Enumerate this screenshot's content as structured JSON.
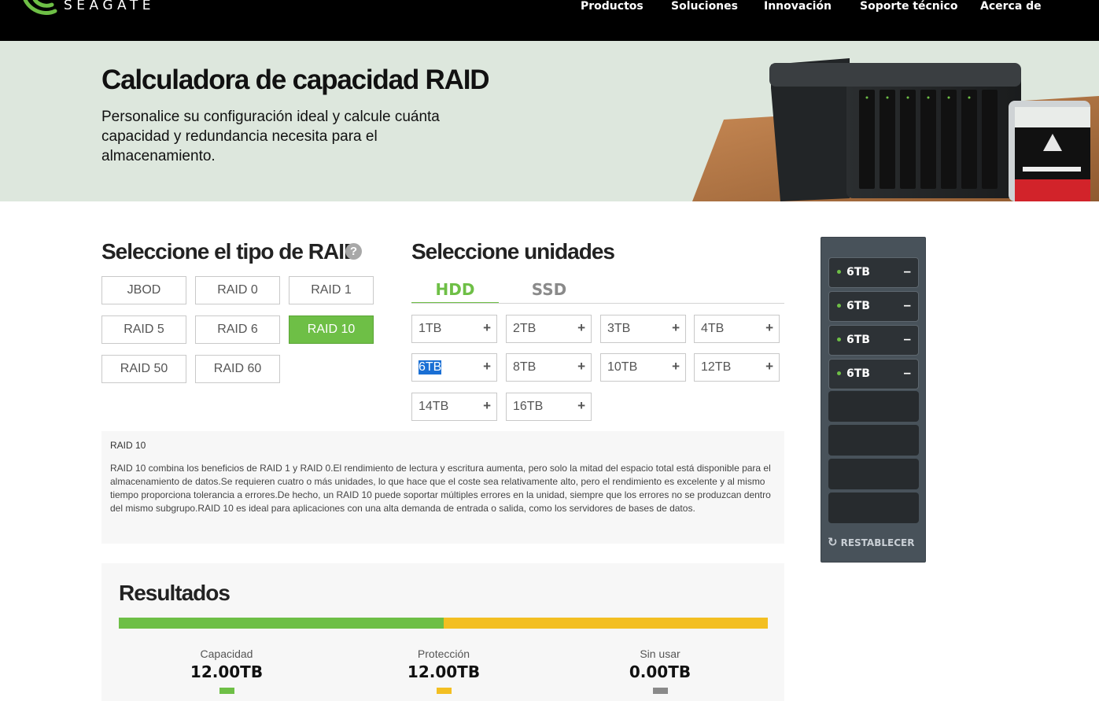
{
  "header": {
    "brand": "SEAGATE",
    "nav": [
      "Productos",
      "Soluciones",
      "Innovación",
      "Soporte técnico",
      "Acerca de"
    ]
  },
  "hero": {
    "title": "Calculadora de capacidad RAID",
    "subtitle": "Personalice su configuración ideal y calcule cuánta capacidad y redundancia necesita para el almacenamiento.",
    "art_icons": [
      "nas-device-image",
      "ironwolf-pro-drive-image"
    ]
  },
  "raid": {
    "heading": "Seleccione el tipo de RAID",
    "help_icon": "?",
    "options": [
      "JBOD",
      "RAID 0",
      "RAID 1",
      "RAID 5",
      "RAID 6",
      "RAID 10",
      "RAID 50",
      "RAID 60"
    ],
    "selected": "RAID 10"
  },
  "drives": {
    "heading": "Seleccione unidades",
    "tabs": [
      "HDD",
      "SSD"
    ],
    "active_tab": "HDD",
    "sizes": [
      "1TB",
      "2TB",
      "3TB",
      "4TB",
      "6TB",
      "8TB",
      "10TB",
      "12TB",
      "14TB",
      "16TB"
    ],
    "highlighted": "6TB",
    "add_icon": "+"
  },
  "description": {
    "title": "RAID 10",
    "body": "RAID 10 combina los beneficios de RAID 1 y RAID 0.El rendimiento de lectura y escritura aumenta, pero solo la mitad del espacio total está disponible para el almacenamiento de datos.Se requieren cuatro o más unidades, lo que hace que el coste sea relativamente alto, pero el rendimiento es excelente y al mismo tiempo proporciona tolerancia a errores.De hecho, un RAID 10 puede soportar múltiples errores en la unidad, siempre que los errores no se produzcan dentro del mismo subgrupo.RAID 10 es ideal para aplicaciones con una alta demanda de entrada o salida, como los servidores de bases de datos."
  },
  "nas": {
    "slots": [
      "6TB",
      "6TB",
      "6TB",
      "6TB",
      "",
      "",
      "",
      ""
    ],
    "remove_icon": "–",
    "reset_label": "RESTABLECER",
    "reset_icon": "↻"
  },
  "results": {
    "title": "Resultados",
    "capacity_fraction": 0.5,
    "stats": [
      {
        "label": "Capacidad",
        "value": "12.00TB",
        "color": "#6ebf46"
      },
      {
        "label": "Protección",
        "value": "12.00TB",
        "color": "#f3bf22"
      },
      {
        "label": "Sin usar",
        "value": "0.00TB",
        "color": "#8a8a8a"
      }
    ]
  },
  "colors": {
    "accent": "#6ebf46",
    "protection": "#f3bf22",
    "nas_panel": "#48525a"
  }
}
